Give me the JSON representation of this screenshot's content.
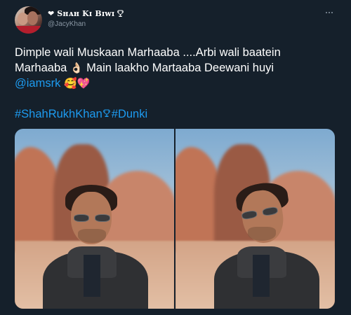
{
  "author": {
    "display_name": "Sʜᴀʜ Kɪ Bɪᴡɪ",
    "handle": "@JacyKhan",
    "name_prefix_icon": "black-heart-icon",
    "name_suffix_icon": "trophy-icon"
  },
  "tweet": {
    "line1": "Dimple wali Muskaan Marhaaba ....Arbi wali baatein",
    "line2_text": "Marhaaba ",
    "line2_emoji": "👌🏻",
    "line2_rest": " Main laakho Martaaba Deewani huyi",
    "mention": "@iamsrk",
    "mention_emojis": " 🥰💖",
    "hashtag1": "#ShahRukhKhan",
    "hashtag2": "#Dunki"
  },
  "media": {
    "count": 2,
    "photos": [
      "photo-1",
      "photo-2"
    ]
  },
  "colors": {
    "background": "#15202b",
    "text": "#ffffff",
    "secondary": "#8b98a5",
    "link": "#1d9bf0"
  }
}
